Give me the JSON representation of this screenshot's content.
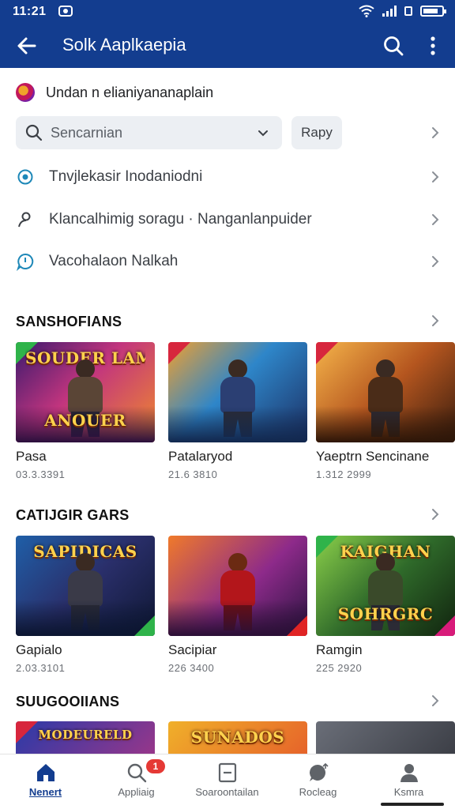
{
  "status_bar": {
    "time": "11:21"
  },
  "app_bar": {
    "title": "Solk Aaplkaepia"
  },
  "header_row": {
    "text": "Undan n elianiyananaplain"
  },
  "search": {
    "placeholder": "Sencarnian",
    "ready_label": "Rapy"
  },
  "menu": [
    {
      "label": "Tnvjlekasir Inodaniodni",
      "icon": "radio-target-icon"
    },
    {
      "label": "Klancalhimig soragu · Nanganlanpuider",
      "icon": "person-outline-icon"
    },
    {
      "label": "Vacohalaon Nalkah",
      "icon": "chat-bubble-icon"
    }
  ],
  "sections": [
    {
      "title": "SANSHOFIANS",
      "items": [
        {
          "name": "Pasa",
          "meta": "03.3.3391",
          "banner": "SOUDER LAME",
          "banner2": "ANOUER"
        },
        {
          "name": "Patalaryod",
          "meta": "21.6 3810",
          "banner": "",
          "banner2": ""
        },
        {
          "name": "Yaeptrn Sencinane",
          "meta": "1.312 2999",
          "banner": "",
          "banner2": ""
        }
      ]
    },
    {
      "title": "CATIJGIR GARS",
      "items": [
        {
          "name": "Gapialo",
          "meta": "2.03.3101",
          "banner": "SAPIDICAS",
          "banner2": ""
        },
        {
          "name": "Sacipiar",
          "meta": "226 3400",
          "banner": "",
          "banner2": ""
        },
        {
          "name": "Ramgin",
          "meta": "225 2920",
          "banner": "KAIGHAN",
          "banner2": "SOHRGRC"
        }
      ]
    },
    {
      "title": "SUUGOOIIANS",
      "items": [
        {
          "banner": "MODEURELD"
        },
        {
          "banner": "SUNADOS"
        },
        {
          "banner": ""
        }
      ]
    }
  ],
  "bottom_nav": [
    {
      "label": "Nenert",
      "icon": "home-icon",
      "active": true
    },
    {
      "label": "Appliaig",
      "icon": "search-icon",
      "badge": "1"
    },
    {
      "label": "Soaroontailan",
      "icon": "tablet-icon"
    },
    {
      "label": "Rocleag",
      "icon": "chat-icon"
    },
    {
      "label": "Ksmra",
      "icon": "person-icon"
    }
  ],
  "colors": {
    "primary": "#133d8f",
    "accent_red": "#e53935"
  }
}
